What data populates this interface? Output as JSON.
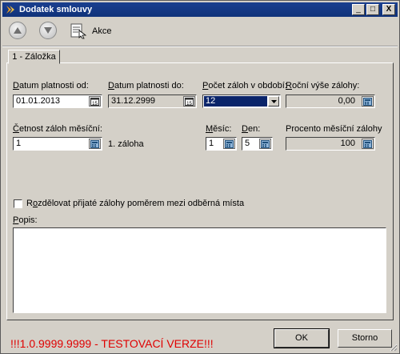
{
  "window": {
    "title": "Dodatek smlouvy",
    "controls": {
      "minimize": "_",
      "maximize": "□",
      "close": "X"
    }
  },
  "toolbar": {
    "up_icon": "arrow-up-icon",
    "down_icon": "arrow-down-icon",
    "akce_label": "Akce"
  },
  "tab": {
    "label": "1 - Záložka"
  },
  "fields": {
    "datum_od": {
      "label": "Datum platnosti od:",
      "value": "01.01.2013"
    },
    "datum_do": {
      "label": "Datum platnosti do:",
      "value": "31.12.2999"
    },
    "pocet_zaloh": {
      "label": "Počet záloh v období:",
      "value": "12"
    },
    "rocni_vyse": {
      "label": "Roční výše zálohy:",
      "value": "0,00"
    },
    "cetnost": {
      "label": "Četnost záloh měsíční:",
      "value": "1"
    },
    "cetnost_note": "1. záloha",
    "mesic": {
      "label": "Měsíc:",
      "value": "1"
    },
    "den": {
      "label": "Den:",
      "value": "5"
    },
    "procento": {
      "label": "Procento měsíční zálohy",
      "value": "100"
    },
    "rozdelovat": {
      "label": "Rozdělovat přijaté zálohy poměrem mezi odběrná místa",
      "checked": false
    },
    "popis": {
      "label": "Popis:",
      "value": ""
    }
  },
  "footer": {
    "warning": "!!!1.0.9999.9999 - TESTOVACÍ VERZE!!!",
    "ok_label": "OK",
    "storno_label": "Storno"
  },
  "colors": {
    "title_bar": "#10327a",
    "warning": "#e00000",
    "selection": "#0a246a"
  }
}
